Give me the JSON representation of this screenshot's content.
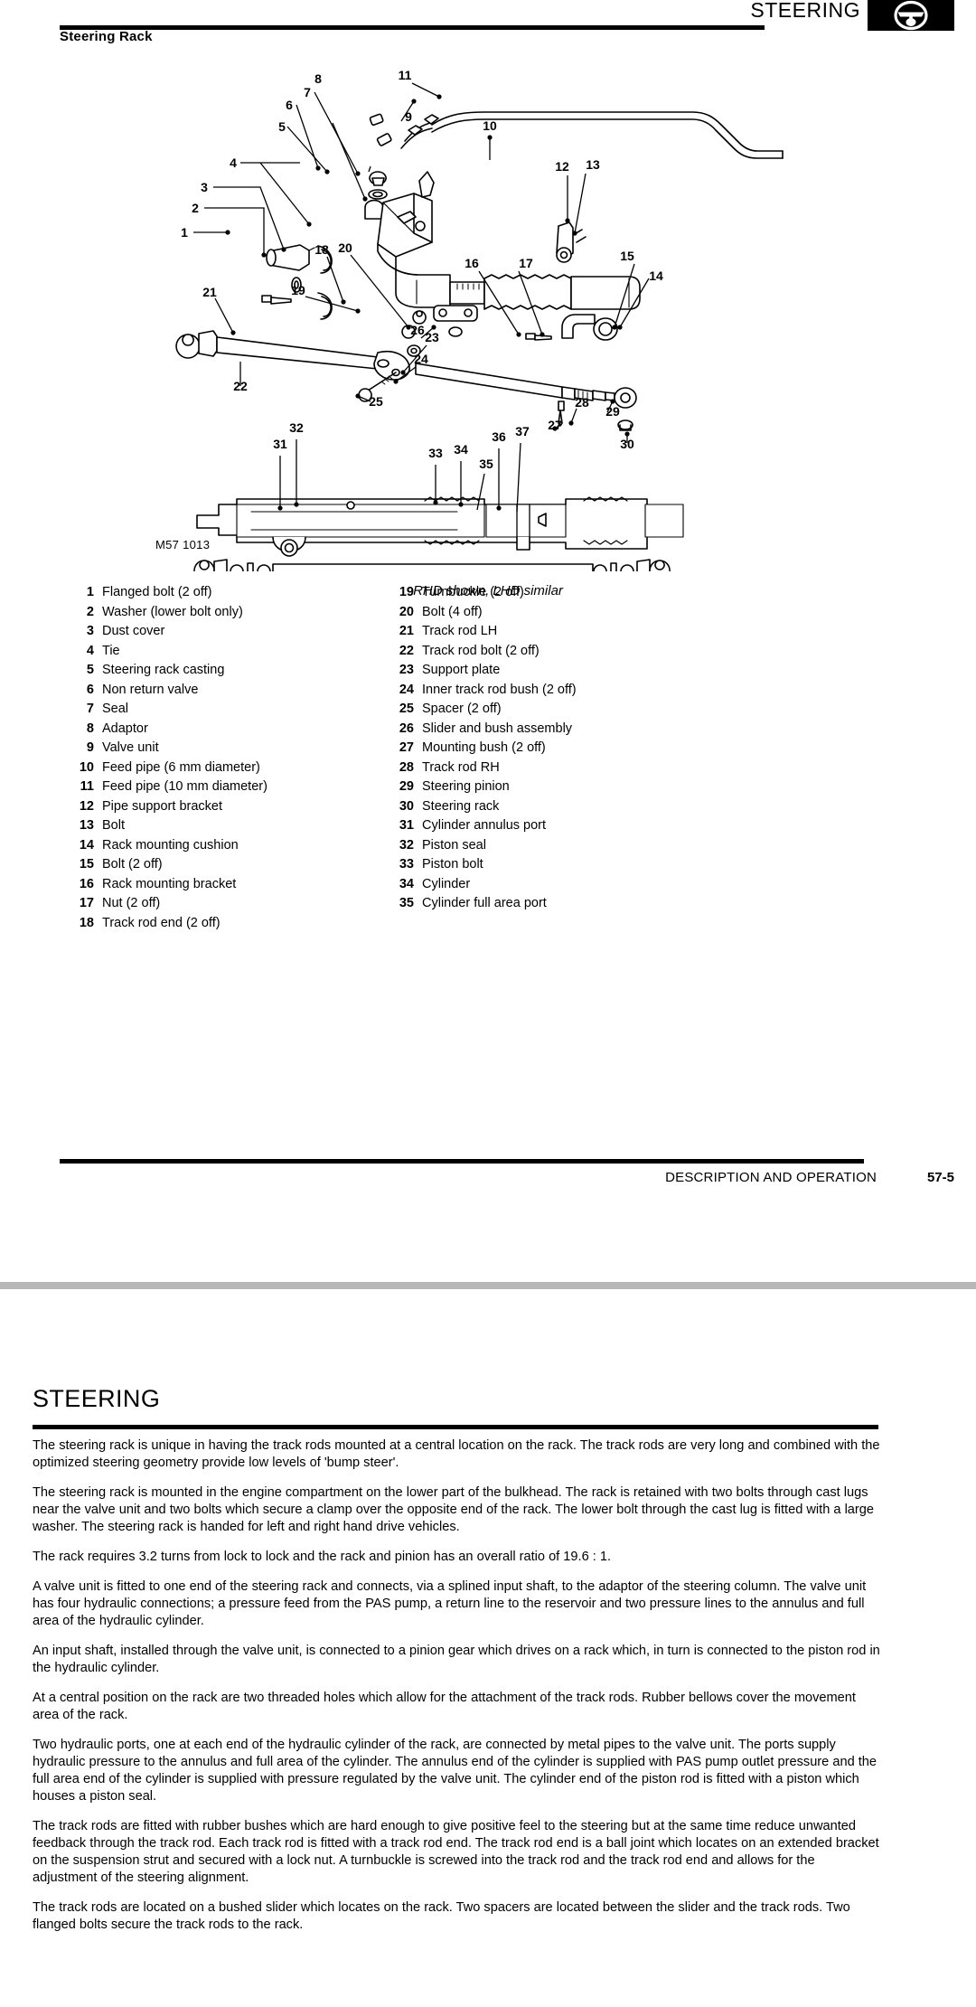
{
  "header": {
    "title": "STEERING",
    "icon": "steering-wheel-icon",
    "section_title": "Steering Rack"
  },
  "diagram": {
    "drawing_number": "M57 1013",
    "caption": "RHD shown, LHD similar",
    "callouts_exploded": [
      "1",
      "2",
      "3",
      "4",
      "5",
      "6",
      "7",
      "8",
      "9",
      "10",
      "11",
      "12",
      "13",
      "14",
      "15",
      "16",
      "17",
      "18",
      "19",
      "20",
      "21",
      "22",
      "23",
      "24",
      "25",
      "26",
      "27",
      "28"
    ],
    "callouts_section": [
      "29",
      "30",
      "31",
      "32",
      "33",
      "34",
      "35"
    ]
  },
  "parts_list": {
    "left_column": [
      {
        "num": "1",
        "label": "Flanged bolt (2 off)"
      },
      {
        "num": "2",
        "label": "Washer (lower bolt only)"
      },
      {
        "num": "3",
        "label": "Dust cover"
      },
      {
        "num": "4",
        "label": "Tie"
      },
      {
        "num": "5",
        "label": "Steering rack casting"
      },
      {
        "num": "6",
        "label": "Non return valve"
      },
      {
        "num": "7",
        "label": "Seal"
      },
      {
        "num": "8",
        "label": "Adaptor"
      },
      {
        "num": "9",
        "label": "Valve unit"
      },
      {
        "num": "10",
        "label": "Feed pipe (6 mm diameter)"
      },
      {
        "num": "11",
        "label": "Feed pipe (10 mm diameter)"
      },
      {
        "num": "12",
        "label": "Pipe support bracket"
      },
      {
        "num": "13",
        "label": "Bolt"
      },
      {
        "num": "14",
        "label": "Rack mounting cushion"
      },
      {
        "num": "15",
        "label": "Bolt (2 off)"
      },
      {
        "num": "16",
        "label": "Rack mounting bracket"
      },
      {
        "num": "17",
        "label": "Nut (2 off)"
      },
      {
        "num": "18",
        "label": "Track rod end (2 off)"
      }
    ],
    "right_column": [
      {
        "num": "19",
        "label": "Turnbuckle (2 off)"
      },
      {
        "num": "20",
        "label": "Bolt (4 off)"
      },
      {
        "num": "21",
        "label": "Track rod LH"
      },
      {
        "num": "22",
        "label": "Track rod bolt (2 off)"
      },
      {
        "num": "23",
        "label": "Support plate"
      },
      {
        "num": "24",
        "label": "Inner track rod bush (2 off)"
      },
      {
        "num": "25",
        "label": "Spacer (2 off)"
      },
      {
        "num": "26",
        "label": "Slider and bush assembly"
      },
      {
        "num": "27",
        "label": "Mounting bush (2 off)"
      },
      {
        "num": "28",
        "label": "Track rod RH"
      },
      {
        "num": "29",
        "label": "Steering pinion"
      },
      {
        "num": "30",
        "label": "Steering rack"
      },
      {
        "num": "31",
        "label": "Cylinder annulus port"
      },
      {
        "num": "32",
        "label": "Piston seal"
      },
      {
        "num": "33",
        "label": "Piston bolt"
      },
      {
        "num": "34",
        "label": "Cylinder"
      },
      {
        "num": "35",
        "label": "Cylinder full area port"
      }
    ]
  },
  "footer": {
    "label": "DESCRIPTION AND OPERATION",
    "page_number": "57-5"
  },
  "page2": {
    "title": "STEERING",
    "paragraphs": [
      "The steering rack is unique in having the track rods mounted at a central location on the rack. The track rods are very long and combined with the optimized steering geometry provide low levels of 'bump steer'.",
      "The steering rack is mounted in the engine compartment on the lower part of the bulkhead. The rack is retained with two bolts through cast lugs near the valve unit and two bolts which secure a clamp over the opposite end of the rack. The lower bolt through the cast lug is fitted with a large washer. The steering rack is handed for left and right hand drive vehicles.",
      "The rack requires 3.2 turns from lock to lock and the rack and pinion has an overall ratio of 19.6 : 1.",
      "A valve unit is fitted to one end of the steering rack and connects, via a splined input shaft, to the adaptor of the steering column. The valve unit has four hydraulic connections; a pressure feed from the PAS pump, a return line to the reservoir and two pressure lines to the annulus and full area of the hydraulic cylinder.",
      "An input shaft, installed through the valve unit, is connected to a pinion gear which drives on a rack which, in turn is connected to the piston rod in the hydraulic cylinder.",
      "At a central position on the rack are two threaded holes which allow for the attachment of the track rods. Rubber bellows cover the movement area of the rack.",
      "Two hydraulic ports, one at each end of the hydraulic cylinder of the rack, are connected by metal pipes to the valve unit. The ports supply hydraulic pressure to the annulus and full area of the cylinder. The annulus end of the cylinder is supplied with PAS pump outlet pressure and the full area end of the cylinder is supplied with pressure regulated by the valve unit. The cylinder end of the piston rod is fitted with a piston which houses a piston seal.",
      "The track rods are fitted with rubber bushes which are hard enough to give positive feel to the steering but at the same time reduce unwanted feedback through the track rod. Each track rod is fitted with a track rod end. The track rod end is a ball joint which locates on an extended bracket on the suspension strut and secured with a lock nut. A turnbuckle is screwed into the track rod and the track rod end and allows for the adjustment of the steering alignment.",
      "The track rods are located on a bushed slider which locates on the rack. Two spacers are located between the slider and the track rods. Two flanged bolts secure the track rods to the rack."
    ]
  }
}
